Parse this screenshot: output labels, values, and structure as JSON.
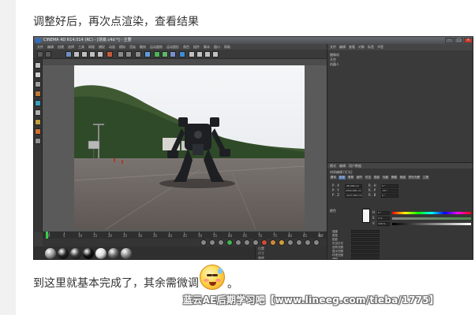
{
  "post": {
    "caption_top": "调整好后，再次点渲染，查看结果",
    "caption_bottom": "到这里就基本完成了，其余需微调",
    "caption_period": "。",
    "watermark": "蓝云AE后期学习吧【www.lineeg.com/tieba/1775】"
  },
  "c4d": {
    "title": "CINEMA 4D R14.014 (RC) - [场景.c4d *] - 主要",
    "menu": [
      "文件",
      "编辑",
      "创建",
      "选择",
      "工具",
      "网格",
      "捕捉",
      "动画",
      "模拟",
      "渲染",
      "雕刻",
      "运动跟踪",
      "运动图形",
      "角色",
      "插件",
      "脚本",
      "窗口",
      "帮助"
    ],
    "layout_label": "界面",
    "layout_value": "启动",
    "object_tabs": [
      "文件",
      "编辑",
      "查看",
      "对象",
      "标签",
      "书签"
    ],
    "objects": [
      "摄像机",
      "天空",
      "机器人"
    ],
    "attr_tabs": [
      "模式",
      "编辑",
      "用户数据"
    ],
    "attr_header": "材质编辑 [灯光]",
    "attr_subtabs": [
      "基本",
      "坐标",
      "常规",
      "细节",
      "可见",
      "投影",
      "光度",
      "焦散",
      "噪波",
      "镜头光晕",
      "工程"
    ],
    "attr_rows": [
      "P . X",
      "P . Y",
      "P . Z",
      "R . H",
      "R . P",
      "R . B"
    ],
    "attr_values": [
      "-36.006 cm",
      "2353.185 cm",
      "-1177.967 cm",
      "0 °",
      "-33 °",
      "0 °"
    ],
    "color_section": "颜色",
    "color_labels": [
      "H",
      "S",
      "V"
    ],
    "color_values": [
      "0 °",
      "0 %",
      "100 %"
    ],
    "attr_bottom": [
      "强度",
      "类型",
      "投影",
      "可见灯光",
      "没有光照",
      "显示光照",
      "环境光照",
      "漫射"
    ],
    "timeline": [
      "0",
      "5",
      "10",
      "15",
      "20",
      "25",
      "30",
      "35",
      "40",
      "45",
      "50",
      "55",
      "60",
      "65",
      "70",
      "75",
      "80",
      "85",
      "90"
    ],
    "timeline_end": "0 F",
    "coords": [
      "位置",
      "尺寸",
      "旋转"
    ],
    "colors": {
      "accent": "#4a6fa5",
      "playhead": "#38d048",
      "panel": "#3a3a3a"
    }
  }
}
